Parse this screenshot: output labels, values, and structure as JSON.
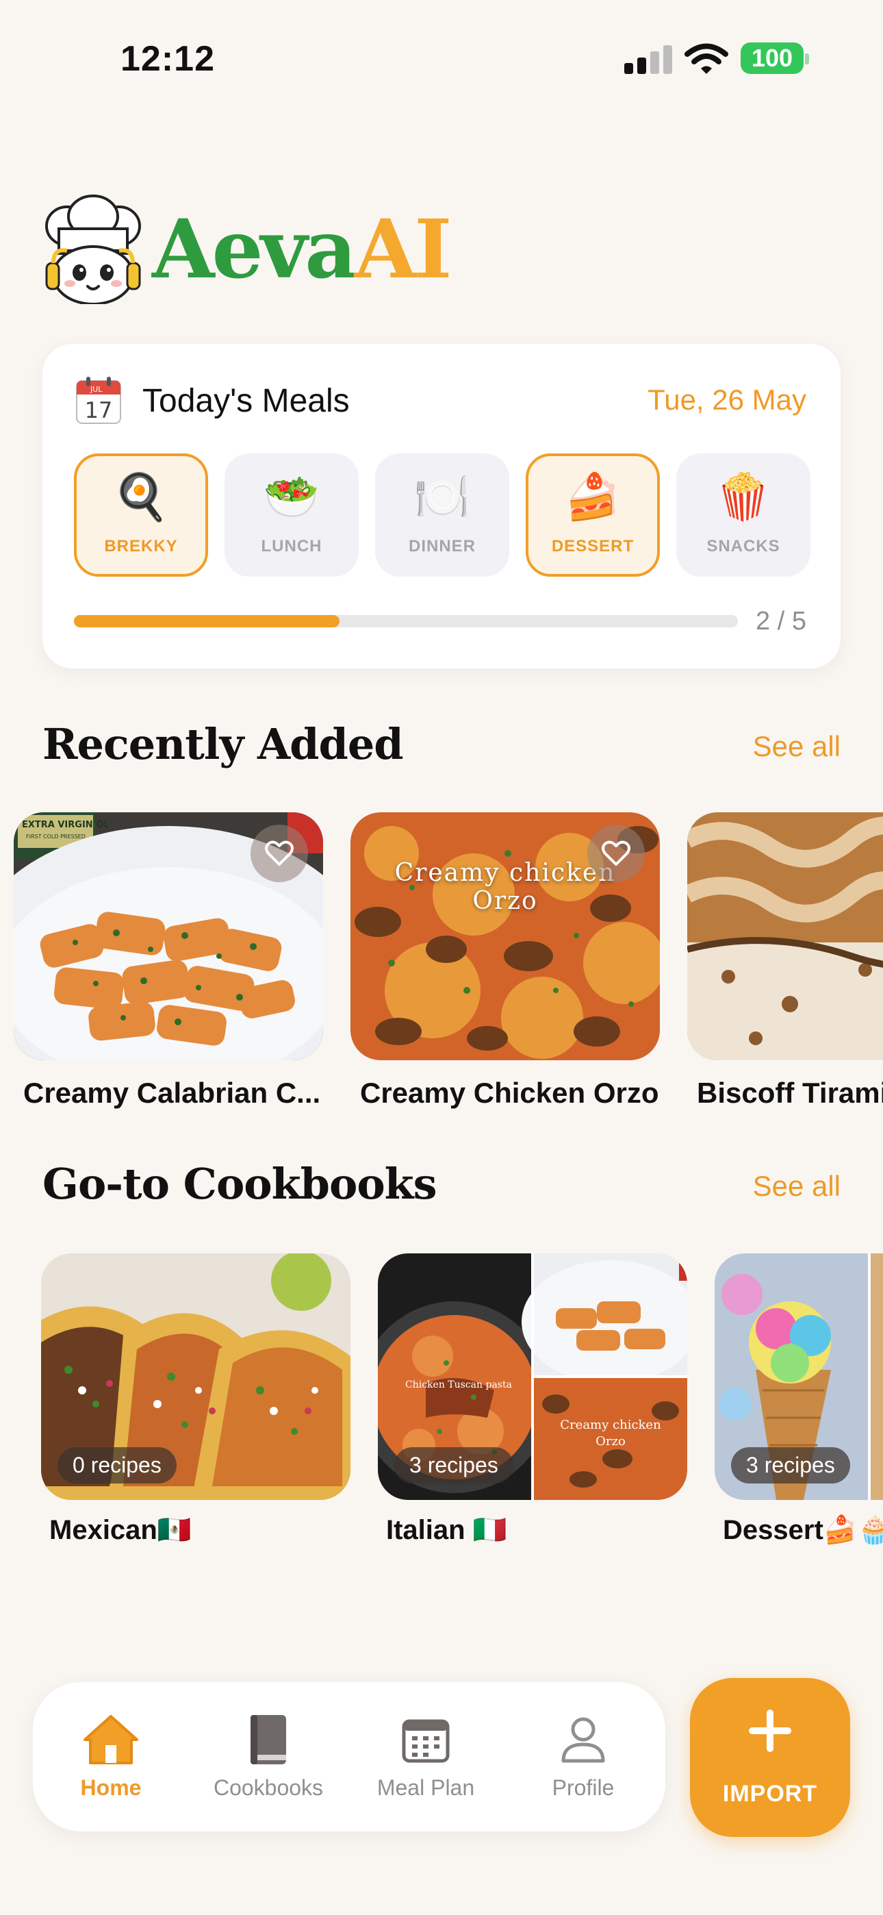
{
  "status_bar": {
    "time": "12:12",
    "battery": "100"
  },
  "logo": {
    "part1": "Aeva",
    "part2": "AI",
    "mascot_icon": "chef-mascot-icon"
  },
  "todays_meals": {
    "calendar_icon": "calendar-icon",
    "calendar_month": "JUL",
    "calendar_day": "17",
    "title": "Today's Meals",
    "date": "Tue, 26 May",
    "meals": [
      {
        "label": "BREKKY",
        "emoji": "🍳",
        "active": true
      },
      {
        "label": "LUNCH",
        "emoji": "🥗",
        "active": false
      },
      {
        "label": "DINNER",
        "emoji": "🍽️",
        "active": false
      },
      {
        "label": "DESSERT",
        "emoji": "🍰",
        "active": true
      },
      {
        "label": "SNACKS",
        "emoji": "🍿",
        "active": false
      }
    ],
    "progress_text": "2 / 5",
    "progress_fraction": 0.4
  },
  "recently_added": {
    "title": "Recently Added",
    "see_all": "See all",
    "recipes": [
      {
        "name": "Creamy Calabrian C...",
        "label_lines": [
          "EXTRA VIRGIN OL",
          "FIRST COLD PRESSED"
        ]
      },
      {
        "name": "Creamy Chicken Orzo",
        "overlay_line1": "Creamy chicken",
        "overlay_line2": "Orzo"
      },
      {
        "name": "Biscoff Tiramis"
      }
    ]
  },
  "cookbooks": {
    "title": "Go-to Cookbooks",
    "see_all": "See all",
    "items": [
      {
        "name": "Mexican🇲🇽",
        "count": "0 recipes"
      },
      {
        "name": "Italian 🇮🇹",
        "count": "3 recipes",
        "overlay_a": "Chicken Tuscan pasta",
        "overlay_b1": "Creamy chicken",
        "overlay_b2": "Orzo"
      },
      {
        "name": "Dessert🍰🧁",
        "count": "3 recipes"
      }
    ]
  },
  "tab_bar": {
    "tabs": [
      {
        "label": "Home",
        "icon": "home-icon",
        "active": true
      },
      {
        "label": "Cookbooks",
        "icon": "book-icon",
        "active": false
      },
      {
        "label": "Meal Plan",
        "icon": "calendar-grid-icon",
        "active": false
      },
      {
        "label": "Profile",
        "icon": "person-icon",
        "active": false
      }
    ],
    "import_label": "IMPORT"
  },
  "colors": {
    "accent": "#f19f27",
    "brand_green": "#2e9b3f",
    "background": "#f9f6f2"
  }
}
